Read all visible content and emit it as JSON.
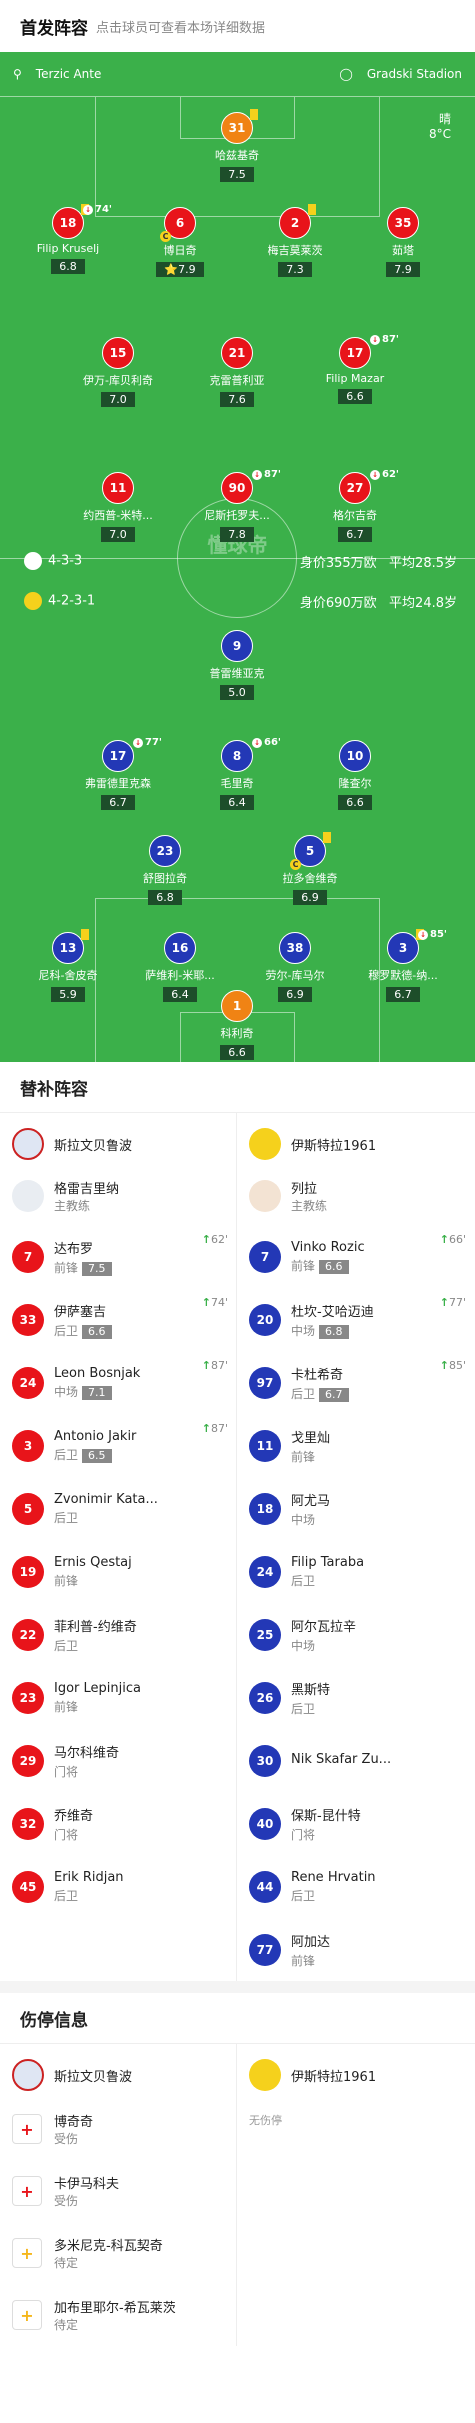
{
  "header": {
    "title": "首发阵容",
    "subtitle": "点击球员可查看本场详细数据"
  },
  "pitch": {
    "coach": "Terzic Ante",
    "stadium": "Gradski Stadion",
    "weather": "晴",
    "temp": "8°C",
    "watermark": "懂球帝",
    "home_formation": "4-3-3",
    "home_value": "身价355万欧",
    "home_age": "平均28.5岁",
    "away_formation": "4-2-3-1",
    "away_value": "身价690万欧",
    "away_age": "平均24.8岁"
  },
  "home_players": [
    {
      "n": "31",
      "name": "哈兹基奇",
      "r": "7.5",
      "c": "orange",
      "card": true
    },
    {
      "n": "18",
      "name": "Filip Kruselj",
      "r": "6.8",
      "c": "red",
      "card": true,
      "sub": "74'"
    },
    {
      "n": "6",
      "name": "博日奇",
      "r": "⭐7.9",
      "c": "red",
      "cap": true
    },
    {
      "n": "2",
      "name": "梅吉莫莱茨",
      "r": "7.3",
      "c": "red",
      "card": true
    },
    {
      "n": "35",
      "name": "茹塔",
      "r": "7.9",
      "c": "red"
    },
    {
      "n": "15",
      "name": "伊万-库贝利奇",
      "r": "7.0",
      "c": "red"
    },
    {
      "n": "21",
      "name": "克雷普利亚",
      "r": "7.6",
      "c": "red"
    },
    {
      "n": "17",
      "name": "Filip Mazar",
      "r": "6.6",
      "c": "red",
      "sub": "87'"
    },
    {
      "n": "11",
      "name": "约西普-米特...",
      "r": "7.0",
      "c": "red"
    },
    {
      "n": "90",
      "name": "尼斯托罗夫...",
      "r": "7.8",
      "c": "red",
      "sub": "87'"
    },
    {
      "n": "27",
      "name": "格尔吉奇",
      "r": "6.7",
      "c": "red",
      "sub": "62'"
    }
  ],
  "away_players": [
    {
      "n": "9",
      "name": "普雷维亚克",
      "r": "5.0",
      "c": "blue"
    },
    {
      "n": "17",
      "name": "弗雷德里克森",
      "r": "6.7",
      "c": "blue",
      "sub": "77'"
    },
    {
      "n": "8",
      "name": "毛里奇",
      "r": "6.4",
      "c": "blue",
      "sub": "66'"
    },
    {
      "n": "10",
      "name": "隆查尔",
      "r": "6.6",
      "c": "blue"
    },
    {
      "n": "23",
      "name": "舒图拉奇",
      "r": "6.8",
      "c": "blue"
    },
    {
      "n": "5",
      "name": "拉多舍维奇",
      "r": "6.9",
      "c": "blue",
      "card": true,
      "cap": true
    },
    {
      "n": "13",
      "name": "尼科-舍皮奇",
      "r": "5.9",
      "c": "blue",
      "card": true
    },
    {
      "n": "16",
      "name": "萨维利-米耶...",
      "r": "6.4",
      "c": "blue"
    },
    {
      "n": "38",
      "name": "劳尔-库马尔",
      "r": "6.9",
      "c": "blue"
    },
    {
      "n": "3",
      "name": "穆罗默德-纳...",
      "r": "6.7",
      "c": "blue",
      "card": true,
      "sub": "85'"
    },
    {
      "n": "1",
      "name": "科利奇",
      "r": "6.6",
      "c": "orange"
    }
  ],
  "subs": {
    "title": "替补阵容",
    "home_team": "斯拉文贝鲁波",
    "away_team": "伊斯特拉1961",
    "home_mgr": {
      "name": "格雷吉里纳",
      "role": "主教练"
    },
    "away_mgr": {
      "name": "列拉",
      "role": "主教练"
    },
    "home": [
      {
        "n": "7",
        "name": "达布罗",
        "pos": "前锋",
        "r": "7.5",
        "in": "62'"
      },
      {
        "n": "33",
        "name": "伊萨塞吉",
        "pos": "后卫",
        "r": "6.6",
        "in": "74'"
      },
      {
        "n": "24",
        "name": "Leon Bosnjak",
        "pos": "中场",
        "r": "7.1",
        "in": "87'"
      },
      {
        "n": "3",
        "name": "Antonio Jakir",
        "pos": "后卫",
        "r": "6.5",
        "in": "87'"
      },
      {
        "n": "5",
        "name": "Zvonimir Kata...",
        "pos": "后卫"
      },
      {
        "n": "19",
        "name": "Ernis Qestaj",
        "pos": "前锋"
      },
      {
        "n": "22",
        "name": "菲利普-约维奇",
        "pos": "后卫"
      },
      {
        "n": "23",
        "name": "Igor Lepinjica",
        "pos": "前锋"
      },
      {
        "n": "29",
        "name": "马尔科维奇",
        "pos": "门将"
      },
      {
        "n": "32",
        "name": "乔维奇",
        "pos": "门将"
      },
      {
        "n": "45",
        "name": "Erik Ridjan",
        "pos": "后卫"
      }
    ],
    "away": [
      {
        "n": "7",
        "name": "Vinko Rozic",
        "pos": "前锋",
        "r": "6.6",
        "in": "66'"
      },
      {
        "n": "20",
        "name": "杜坎-艾哈迈迪",
        "pos": "中场",
        "r": "6.8",
        "in": "77'"
      },
      {
        "n": "97",
        "name": "卡杜希奇",
        "pos": "后卫",
        "r": "6.7",
        "in": "85'"
      },
      {
        "n": "11",
        "name": "戈里灿",
        "pos": "前锋"
      },
      {
        "n": "18",
        "name": "阿尤马",
        "pos": "中场"
      },
      {
        "n": "24",
        "name": "Filip Taraba",
        "pos": "后卫"
      },
      {
        "n": "25",
        "name": "阿尔瓦拉辛",
        "pos": "中场"
      },
      {
        "n": "26",
        "name": "黑斯特",
        "pos": "后卫"
      },
      {
        "n": "30",
        "name": "Nik Skafar Zu...",
        "pos": ""
      },
      {
        "n": "40",
        "name": "保斯-昆什特",
        "pos": "门将"
      },
      {
        "n": "44",
        "name": "Rene Hrvatin",
        "pos": "后卫"
      },
      {
        "n": "77",
        "name": "阿加达",
        "pos": "前锋"
      }
    ]
  },
  "injuries": {
    "title": "伤停信息",
    "none": "无伤停",
    "home": [
      {
        "name": "博奇奇",
        "status": "受伤",
        "t": "red"
      },
      {
        "name": "卡伊马科夫",
        "status": "受伤",
        "t": "red"
      },
      {
        "name": "多米尼克-科瓦契奇",
        "status": "待定",
        "t": "yellow"
      },
      {
        "name": "加布里耶尔-希瓦莱茨",
        "status": "待定",
        "t": "yellow"
      }
    ]
  }
}
